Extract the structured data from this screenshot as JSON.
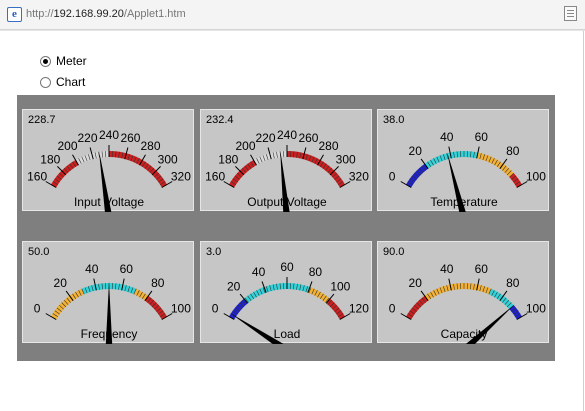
{
  "browser": {
    "url_prefix": "http://",
    "url_host": "192.168.99.20",
    "url_path": "/Applet1.htm"
  },
  "view_options": [
    {
      "label": "Meter",
      "selected": true
    },
    {
      "label": "Chart",
      "selected": false
    }
  ],
  "gauges": [
    {
      "title": "Input Voltage",
      "value": 228.7,
      "display": "228.7",
      "min": 160,
      "max": 320,
      "ticks": [
        "160",
        "180",
        "200",
        "220",
        "240",
        "260",
        "280",
        "300",
        "320"
      ],
      "segments": [
        {
          "from": 160,
          "to": 200,
          "color": "#cc1f1f"
        },
        {
          "from": 200,
          "to": 240,
          "color": "#d8d8d8"
        },
        {
          "from": 240,
          "to": 320,
          "color": "#cc1f1f"
        }
      ]
    },
    {
      "title": "Output Voltage",
      "value": 232.4,
      "display": "232.4",
      "min": 160,
      "max": 320,
      "ticks": [
        "160",
        "180",
        "200",
        "220",
        "240",
        "260",
        "280",
        "300",
        "320"
      ],
      "segments": [
        {
          "from": 160,
          "to": 200,
          "color": "#cc1f1f"
        },
        {
          "from": 200,
          "to": 240,
          "color": "#d8d8d8"
        },
        {
          "from": 240,
          "to": 320,
          "color": "#cc1f1f"
        }
      ]
    },
    {
      "title": "Temperature",
      "value": 38.0,
      "display": "38.0",
      "min": 0,
      "max": 100,
      "ticks": [
        "0",
        "20",
        "40",
        "60",
        "80",
        "100"
      ],
      "segments": [
        {
          "from": 0,
          "to": 20,
          "color": "#1e22c8"
        },
        {
          "from": 20,
          "to": 60,
          "color": "#33d2d8"
        },
        {
          "from": 60,
          "to": 90,
          "color": "#f2b035"
        },
        {
          "from": 90,
          "to": 100,
          "color": "#cc1f1f"
        }
      ]
    },
    {
      "title": "Frequency",
      "value": 50.0,
      "display": "50.0",
      "min": 0,
      "max": 100,
      "ticks": [
        "0",
        "20",
        "40",
        "60",
        "80",
        "100"
      ],
      "segments": [
        {
          "from": 0,
          "to": 30,
          "color": "#f2b035"
        },
        {
          "from": 30,
          "to": 70,
          "color": "#33d2d8"
        },
        {
          "from": 70,
          "to": 80,
          "color": "#f2b035"
        },
        {
          "from": 80,
          "to": 100,
          "color": "#cc1f1f"
        }
      ]
    },
    {
      "title": "Load",
      "value": 3.0,
      "display": "3.0",
      "min": 0,
      "max": 120,
      "ticks": [
        "0",
        "20",
        "40",
        "60",
        "80",
        "100",
        "120"
      ],
      "segments": [
        {
          "from": 0,
          "to": 20,
          "color": "#1e22c8"
        },
        {
          "from": 20,
          "to": 80,
          "color": "#33d2d8"
        },
        {
          "from": 80,
          "to": 100,
          "color": "#f2b035"
        },
        {
          "from": 100,
          "to": 120,
          "color": "#cc1f1f"
        }
      ]
    },
    {
      "title": "Capacity",
      "value": 90.0,
      "display": "90.0",
      "min": 0,
      "max": 100,
      "ticks": [
        "0",
        "20",
        "40",
        "60",
        "80",
        "100"
      ],
      "segments": [
        {
          "from": 0,
          "to": 20,
          "color": "#cc1f1f"
        },
        {
          "from": 20,
          "to": 70,
          "color": "#f2b035"
        },
        {
          "from": 70,
          "to": 90,
          "color": "#33d2d8"
        },
        {
          "from": 90,
          "to": 100,
          "color": "#1e22c8"
        }
      ]
    }
  ]
}
